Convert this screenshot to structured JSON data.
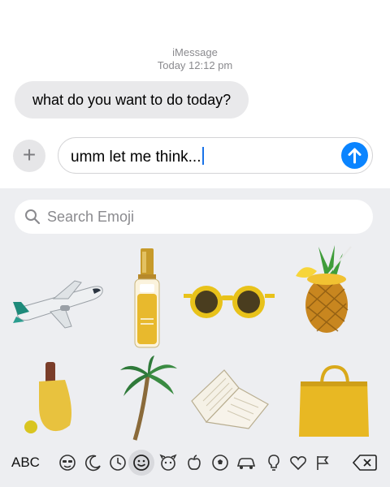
{
  "conversation": {
    "service": "iMessage",
    "timestamp": "Today 12:12 pm",
    "messages": [
      {
        "text": "what do you want to do today?"
      }
    ]
  },
  "compose": {
    "text": "umm let me think..."
  },
  "emoji_keyboard": {
    "search_placeholder": "Search Emoji",
    "abc_label": "ABC",
    "stickers": [
      "airplane",
      "hair-serum-bottle",
      "yellow-sunglasses",
      "pineapple-drink",
      "pickleball-paddle",
      "palm-tree",
      "open-book",
      "yellow-shopping-bag"
    ],
    "categories": [
      "memoji-icon",
      "stickers-moon-icon",
      "recent-clock-icon",
      "smiley-icon",
      "animal-icon",
      "food-apple-icon",
      "activity-ball-icon",
      "travel-car-icon",
      "objects-bulb-icon",
      "symbols-heart-icon",
      "flags-icon"
    ],
    "selected_category": "smiley-icon"
  },
  "colors": {
    "send_button": "#0a84ff",
    "incoming_bubble": "#e9e9eb",
    "keyboard_bg": "#edeef1"
  }
}
